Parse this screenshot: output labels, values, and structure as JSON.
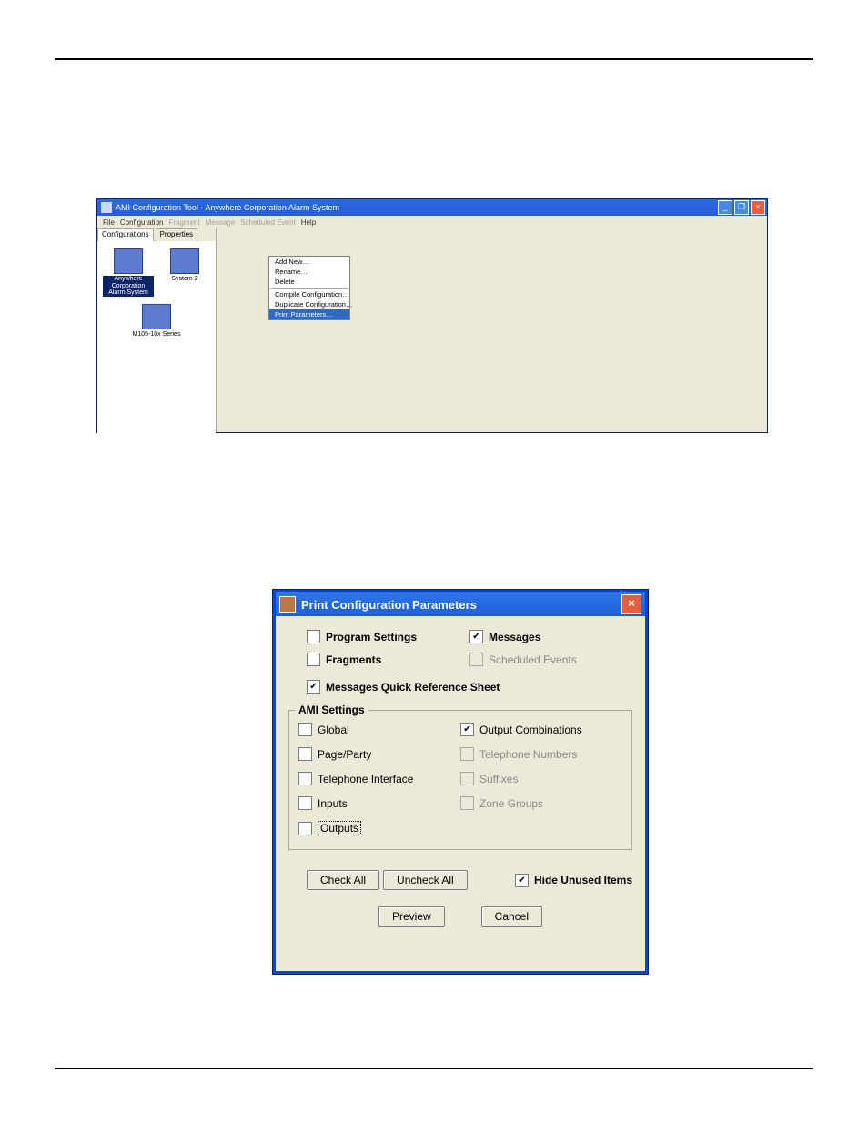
{
  "app": {
    "title": "AMI Configuration Tool - Anywhere Corporation Alarm System",
    "menubar": [
      "File",
      "Configuration",
      "Fragment",
      "Message",
      "Scheduled Event",
      "Help"
    ],
    "menubar_disabled": [
      false,
      false,
      true,
      true,
      true,
      false
    ],
    "tabs": {
      "configurations": "Configurations",
      "properties": "Properties"
    },
    "configs": {
      "selected": "Anywhere Corporation Alarm System",
      "second": "System 2",
      "third": "M105-10x Series"
    },
    "context_menu": {
      "add_new": "Add New…",
      "rename": "Rename…",
      "delete": "Delete",
      "compile": "Compile Configuration…",
      "duplicate": "Duplicate Configuration…",
      "print_params": "Print Parameters…"
    },
    "winbtns": {
      "min": "_",
      "max": "❐",
      "close": "×"
    }
  },
  "dialog": {
    "title": "Print Configuration Parameters",
    "close": "×",
    "top": {
      "program_settings": "Program Settings",
      "messages": "Messages",
      "fragments": "Fragments",
      "scheduled_events": "Scheduled Events",
      "messages_quick_ref": "Messages Quick Reference Sheet"
    },
    "group_title": "AMI Settings",
    "ami": {
      "global": "Global",
      "output_combinations": "Output Combinations",
      "page_party": "Page/Party",
      "telephone_numbers": "Telephone Numbers",
      "telephone_interface": "Telephone Interface",
      "suffixes": "Suffixes",
      "inputs": "Inputs",
      "zone_groups": "Zone Groups",
      "outputs": "Outputs"
    },
    "buttons": {
      "check_all": "Check All",
      "uncheck_all": "Uncheck All",
      "hide_unused": "Hide Unused Items",
      "preview": "Preview",
      "cancel": "Cancel"
    }
  }
}
